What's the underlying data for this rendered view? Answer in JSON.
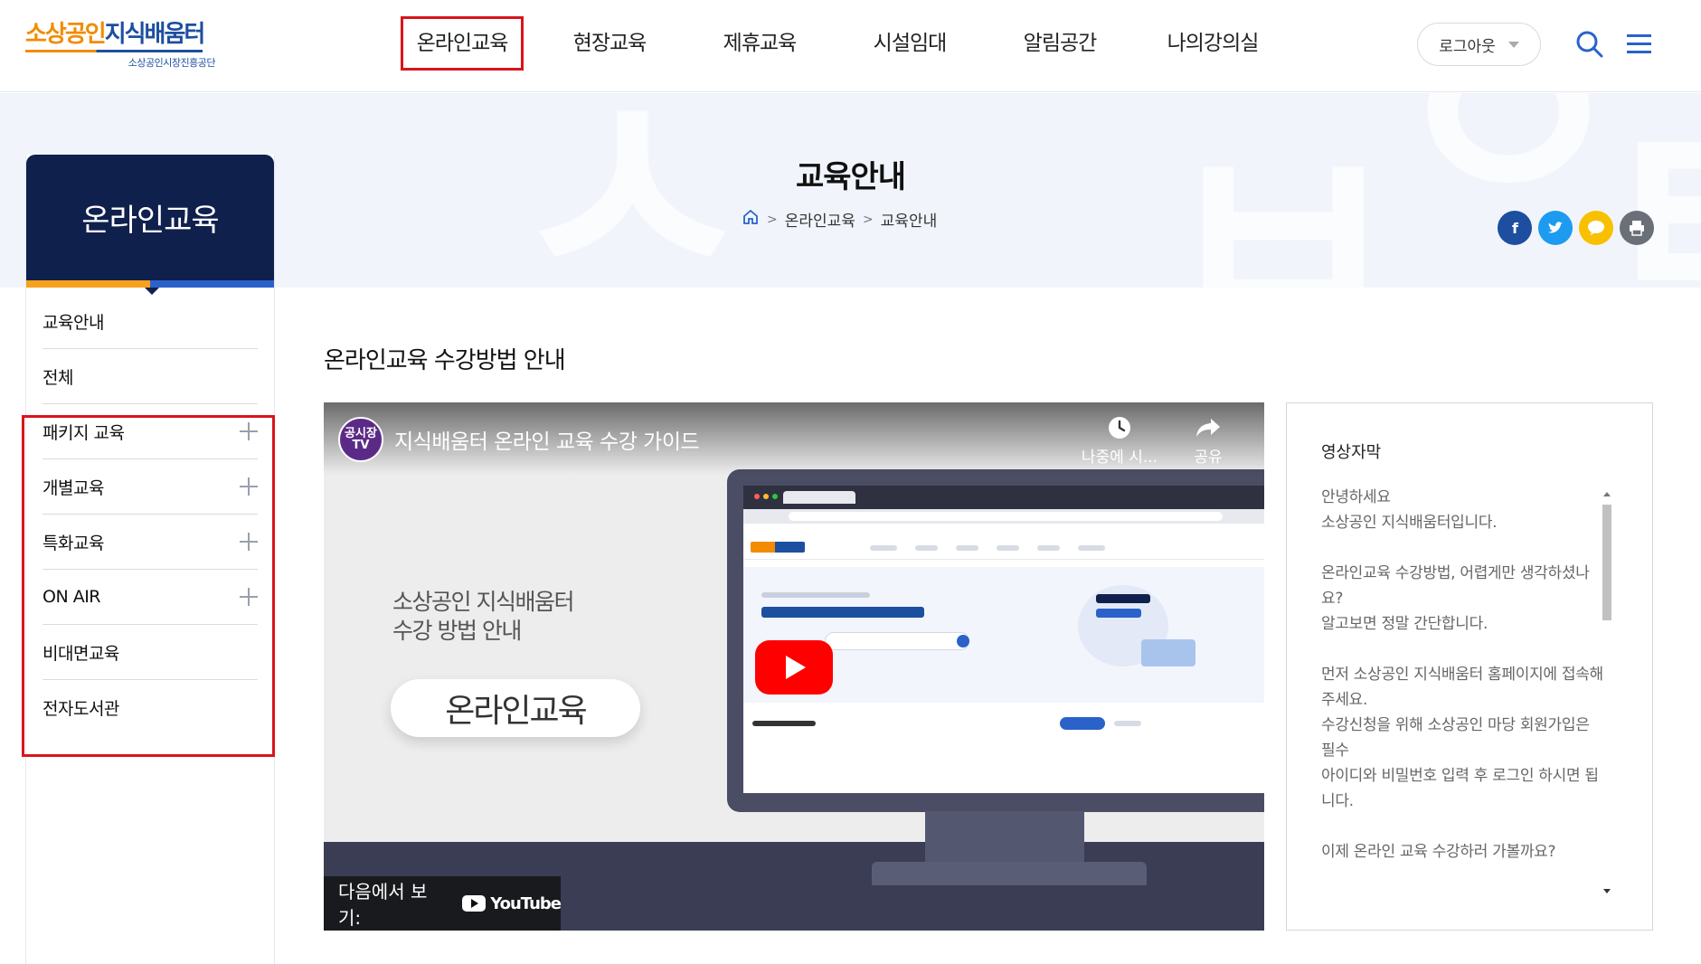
{
  "header": {
    "logo": {
      "main_part1": "소상공인",
      "main_part2": "지식배움터",
      "sub": "소상공인시장진흥공단"
    },
    "nav": [
      {
        "label": "온라인교육",
        "active": true
      },
      {
        "label": "현장교육",
        "active": false
      },
      {
        "label": "제휴교육",
        "active": false
      },
      {
        "label": "시설임대",
        "active": false
      },
      {
        "label": "알림공간",
        "active": false
      },
      {
        "label": "나의강의실",
        "active": false
      }
    ],
    "logout_label": "로그아웃",
    "icons": [
      "search-icon",
      "menu-icon"
    ]
  },
  "visual": {
    "page_title": "교육안내",
    "breadcrumb": [
      "온라인교육",
      "교육안내"
    ],
    "share": [
      {
        "name": "facebook",
        "color": "#1d4ea0"
      },
      {
        "name": "twitter",
        "color": "#1d9bf0"
      },
      {
        "name": "kakaotalk",
        "color": "#f9c000"
      },
      {
        "name": "print",
        "color": "#6b6f78"
      }
    ]
  },
  "lnb": {
    "title": "온라인교육",
    "items": [
      {
        "label": "교육안내",
        "expandable": false
      },
      {
        "label": "전체",
        "expandable": false
      },
      {
        "label": "패키지 교육",
        "expandable": true
      },
      {
        "label": "개별교육",
        "expandable": true
      },
      {
        "label": "특화교육",
        "expandable": true
      },
      {
        "label": "ON AIR",
        "expandable": true
      },
      {
        "label": "비대면교육",
        "expandable": false
      },
      {
        "label": "전자도서관",
        "expandable": false
      }
    ]
  },
  "content": {
    "section_title": "온라인교육 수강방법 안내",
    "video": {
      "channel_badge": "공시장 TV",
      "title": "지식배움터 온라인 교육 수강 가이드",
      "watch_later": "나중에 시...",
      "share": "공유",
      "promo_line1": "소상공인 지식배움터",
      "promo_line2": "수강 방법 안내",
      "promo_pill": "온라인교육",
      "watch_on": "다음에서 보기:",
      "youtube": "YouTube"
    },
    "subtitles": {
      "title": "영상자막",
      "paragraphs": [
        "안녕하세요\n소상공인 지식배움터입니다.",
        "온라인교육 수강방법, 어렵게만 생각하셨나요?\n알고보면 정말 간단합니다.",
        "먼저 소상공인 지식배움터 홈페이지에 접속해주세요.\n수강신청을 위해 소상공인 마당 회원가입은 필수\n아이디와 비밀번호 입력 후 로그인 하시면 됩니다.",
        "이제 온라인 교육 수강하러 가볼까요?"
      ]
    }
  },
  "colors": {
    "primary_navy": "#10204d",
    "accent_orange": "#f28b00",
    "accent_blue": "#1d4fa0",
    "highlight_red": "#d9151b"
  }
}
